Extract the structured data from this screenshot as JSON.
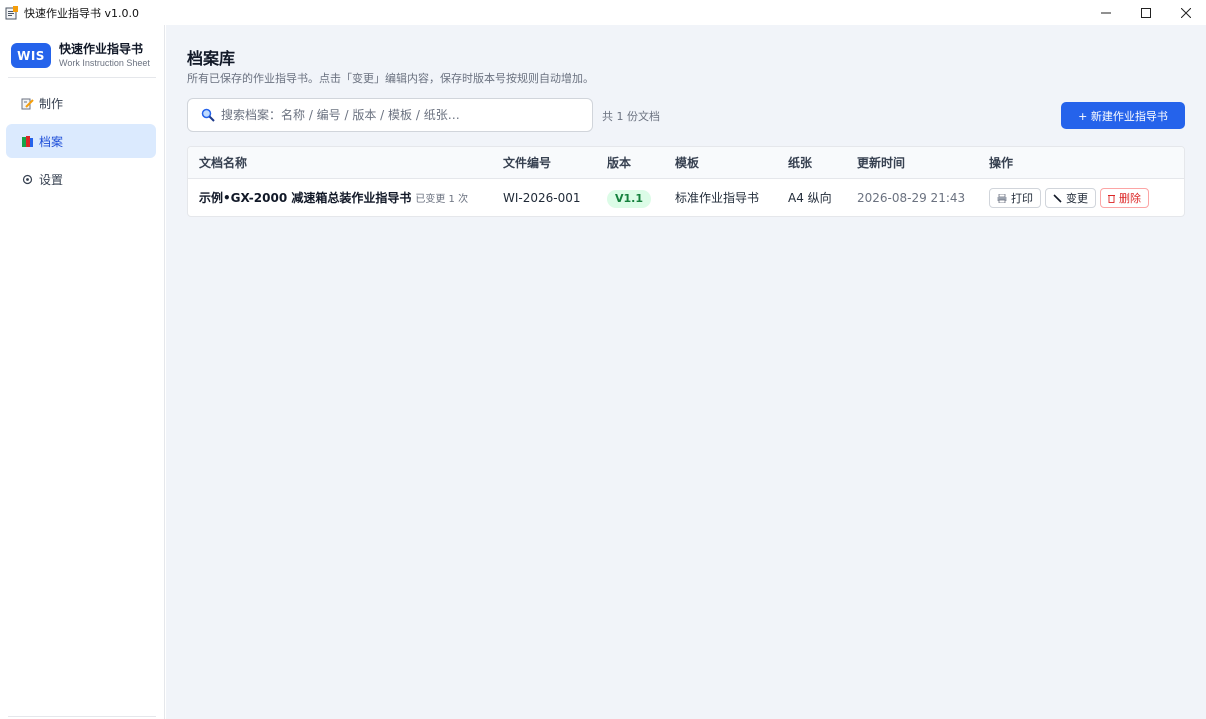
{
  "window": {
    "title": "快速作业指导书 v1.0.0"
  },
  "brand": {
    "logo": "WIS",
    "name": "快速作业指导书",
    "subtitle": "Work Instruction Sheet"
  },
  "sidebar": {
    "items": [
      {
        "label": "制作",
        "icon": "pencil-note-icon",
        "active": false
      },
      {
        "label": "档案",
        "icon": "books-icon",
        "active": true
      },
      {
        "label": "设置",
        "icon": "gear-icon",
        "active": false
      }
    ]
  },
  "page": {
    "title": "档案库",
    "description": "所有已保存的作业指导书。点击「变更」编辑内容，保存时版本号按规则自动增加。"
  },
  "search": {
    "placeholder": "搜索档案：名称 / 编号 / 版本 / 模板 / 纸张…",
    "value": ""
  },
  "doc_count": "共 1 份文档",
  "new_button_label": "+ 新建作业指导书",
  "table": {
    "columns": [
      "文档名称",
      "文件编号",
      "版本",
      "模板",
      "纸张",
      "更新时间",
      "操作"
    ],
    "rows": [
      {
        "name": "示例•GX-2000 减速箱总装作业指导书",
        "change_note": "已变更 1 次",
        "code": "WI-2026-001",
        "version": "V1.1",
        "template": "标准作业指导书",
        "paper": "A4 纵向",
        "updated": "2026-08-29 21:43",
        "actions": {
          "print": "打印",
          "edit": "变更",
          "delete": "删除"
        }
      }
    ]
  },
  "colors": {
    "accent": "#2563eb",
    "active_nav_bg": "#dbeafe",
    "badge_bg": "#dcfce7",
    "badge_text": "#15803d",
    "danger": "#dc2626",
    "main_bg": "#f1f4f9"
  }
}
